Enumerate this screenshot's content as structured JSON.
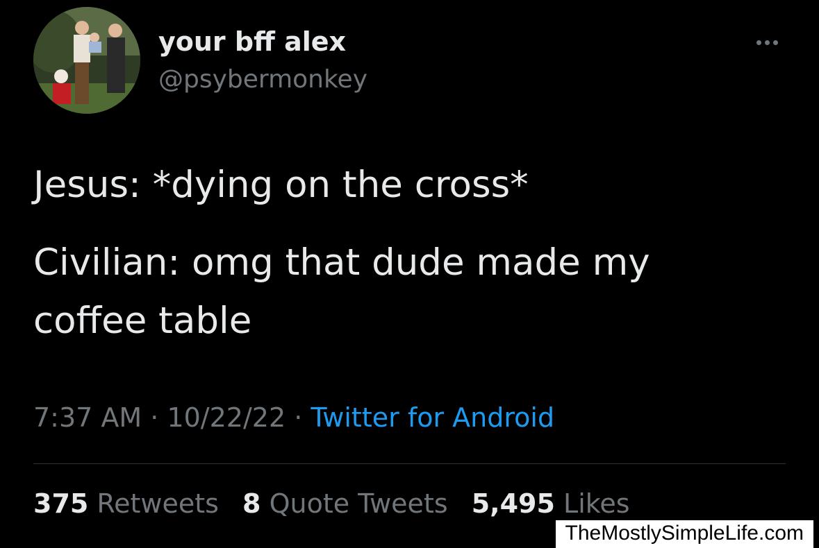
{
  "author": {
    "display_name": "your bff alex",
    "handle": "@psybermonkey",
    "avatar_icon": "profile-photo-avatar"
  },
  "more_icon": "more-options-icon",
  "tweet": {
    "lines": [
      "Jesus: *dying on the cross*",
      "Civilian: omg that dude made my",
      "coffee table"
    ]
  },
  "meta": {
    "time": "7:37 AM",
    "separator": " · ",
    "date": "10/22/22",
    "source": "Twitter for Android"
  },
  "stats": {
    "retweets_count": "375",
    "retweets_label": "Retweets",
    "quotes_count": "8",
    "quotes_label": "Quote Tweets",
    "likes_count": "5,495",
    "likes_label": "Likes"
  },
  "watermark": "TheMostlySimpleLife.com",
  "colors": {
    "background": "#000000",
    "primary_text": "#e7e9ea",
    "secondary_text": "#71767b",
    "link": "#1d9bf0"
  }
}
